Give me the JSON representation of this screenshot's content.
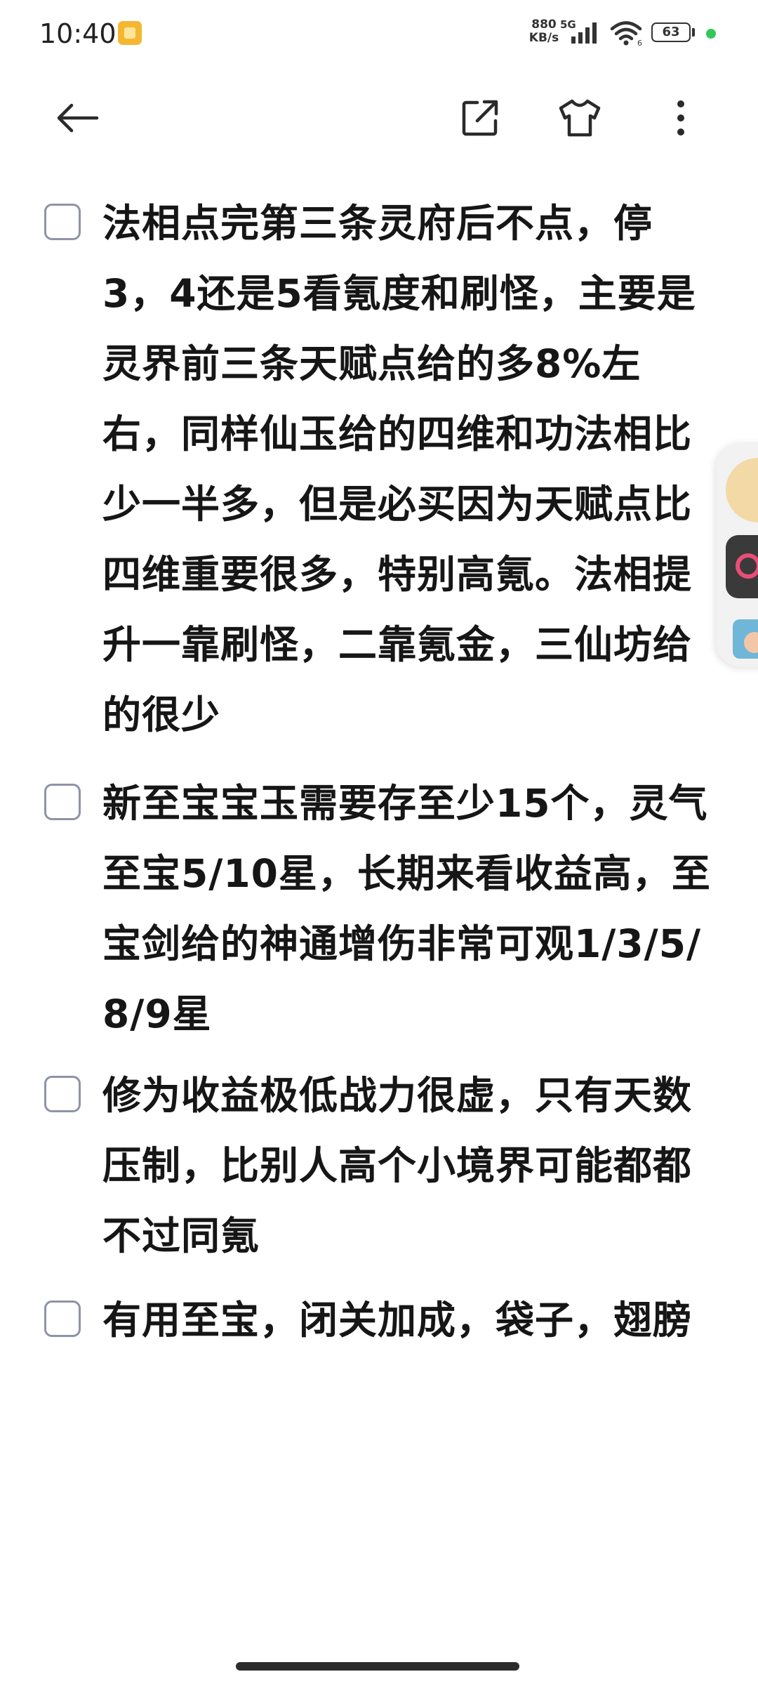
{
  "status_bar": {
    "time": "10:40",
    "net_speed_value": "880",
    "net_speed_unit": "KB/s",
    "network_type": "5G",
    "battery_level": "63"
  },
  "toolbar": {
    "back_icon": "arrow-left-icon",
    "share_icon": "share-external-icon",
    "theme_icon": "tshirt-icon",
    "more_icon": "vertical-dots-icon"
  },
  "checklist": {
    "items": [
      {
        "checked": false,
        "text": "法相点完第三条灵府后不点，停3，4还是5看氪度和刷怪，主要是灵界前三条天赋点给的多8%左右，同样仙玉给的四维和功法相比少一半多，但是必买因为天赋点比四维重要很多，特别高氪。法相提升一靠刷怪，二靠氪金，三仙坊给的很少"
      },
      {
        "checked": false,
        "text": "新至宝宝玉需要存至少15个，灵气至宝5/10星，长期来看收益高，至宝剑给的神通增伤非常可观1/3/5/8/9星"
      },
      {
        "checked": false,
        "text": "修为收益极低战力很虚，只有天数压制，比别人高个小境界可能都都不过同氪"
      },
      {
        "checked": false,
        "text": "有用至宝，闭关加成，袋子，翅膀"
      }
    ]
  }
}
